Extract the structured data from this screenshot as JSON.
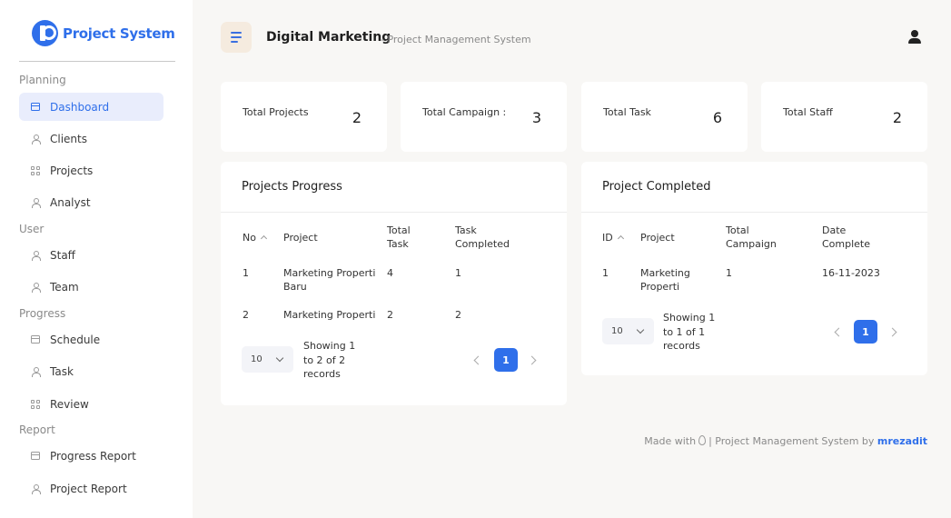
{
  "brand": {
    "name": "Project System"
  },
  "sidebar": {
    "sections": [
      {
        "label": "Planning"
      },
      {
        "label": "User"
      },
      {
        "label": "Progress"
      },
      {
        "label": "Report"
      }
    ],
    "items": [
      {
        "label": "Dashboard",
        "icon": "calendar-icon"
      },
      {
        "label": "Clients",
        "icon": "user-icon"
      },
      {
        "label": "Projects",
        "icon": "grid-icon"
      },
      {
        "label": "Analyst",
        "icon": "user-icon"
      },
      {
        "label": "Staff",
        "icon": "user-icon"
      },
      {
        "label": "Team",
        "icon": "users-icon"
      },
      {
        "label": "Schedule",
        "icon": "calendar-icon"
      },
      {
        "label": "Task",
        "icon": "user-icon"
      },
      {
        "label": "Review",
        "icon": "grid-icon"
      },
      {
        "label": "Progress Report",
        "icon": "calendar-icon"
      },
      {
        "label": "Project Report",
        "icon": "user-icon"
      }
    ]
  },
  "header": {
    "title": "Digital Marketing",
    "subtitle": "- Project Management System"
  },
  "stats": [
    {
      "label": "Total Projects",
      "value": "2"
    },
    {
      "label": "Total Campaign :",
      "value": "3"
    },
    {
      "label": "Total Task",
      "value": "6"
    },
    {
      "label": "Total Staff",
      "value": "2"
    }
  ],
  "progress_panel": {
    "title": "Projects Progress",
    "headers": [
      "No",
      "Project",
      "Total Task",
      "Task Completed"
    ],
    "rows": [
      {
        "no": "1",
        "project": "Marketing Properti Baru",
        "total": "4",
        "completed": "1"
      },
      {
        "no": "2",
        "project": "Marketing Properti",
        "total": "2",
        "completed": "2"
      }
    ],
    "page_size": "10",
    "showing": "Showing 1 to 2 of 2 records",
    "current_page": "1"
  },
  "completed_panel": {
    "title": "Project Completed",
    "headers": [
      "ID",
      "Project",
      "Total Campaign",
      "Date Complete"
    ],
    "rows": [
      {
        "id": "1",
        "project": "Marketing Properti",
        "campaign": "1",
        "date": "16-11-2023"
      }
    ],
    "page_size": "10",
    "showing": "Showing 1 to 1 of 1 records",
    "current_page": "1"
  },
  "footer": {
    "made_with": "Made with",
    "middle": "| Project Management System by",
    "author": "mrezadit"
  },
  "colors": {
    "accent": "#2f6fea",
    "active_bg": "#e9edfc",
    "menu_button_bg": "#f5ebdf",
    "page_bg": "#f8f7f5"
  }
}
